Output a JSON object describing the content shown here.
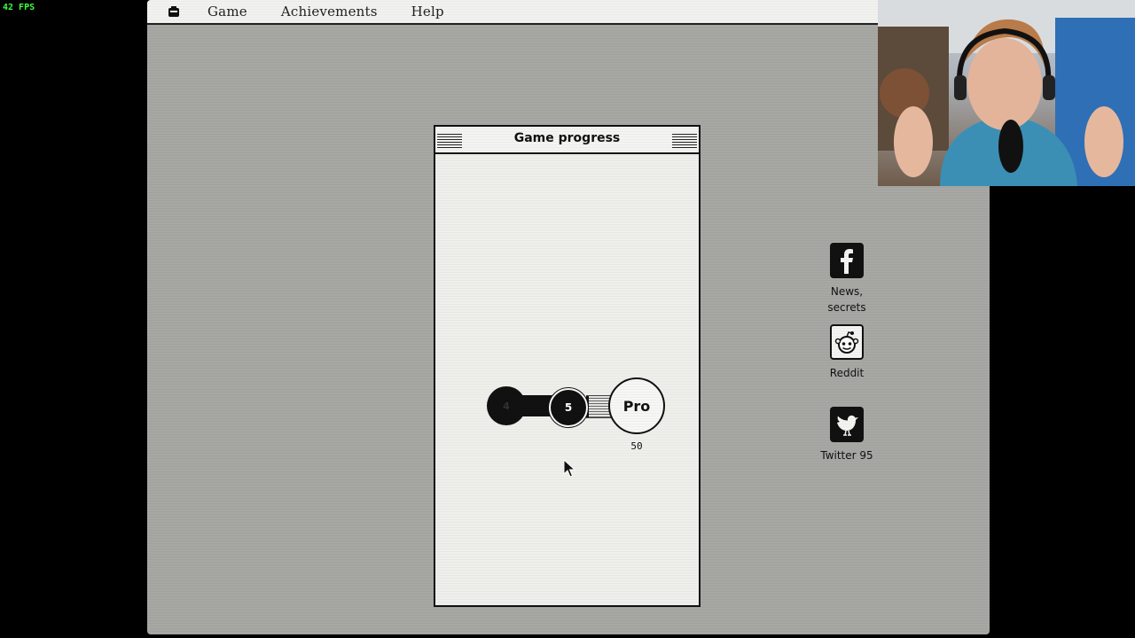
{
  "overlay": {
    "fps": "42 FPS"
  },
  "menubar": {
    "items": [
      "Game",
      "Achievements",
      "Help"
    ],
    "apple_icon": "system-icon",
    "right_icon": "heart-icon"
  },
  "window": {
    "title": "Game progress",
    "track": {
      "completed_level": "4",
      "current_level": "5",
      "next_level": "Pro",
      "next_value": "50",
      "progress_to_next": 0.1
    }
  },
  "sidebar": [
    {
      "icon": "facebook-icon",
      "label_lines": [
        "News,",
        "secrets"
      ]
    },
    {
      "icon": "reddit-icon",
      "label_lines": [
        "Reddit"
      ]
    },
    {
      "icon": "twitter-icon",
      "label_lines": [
        "Twitter 95"
      ]
    }
  ],
  "colors": {
    "desktop": "#a7a7a4",
    "window": "#efefec",
    "fps": "#3cff3c",
    "ink": "#111111"
  }
}
